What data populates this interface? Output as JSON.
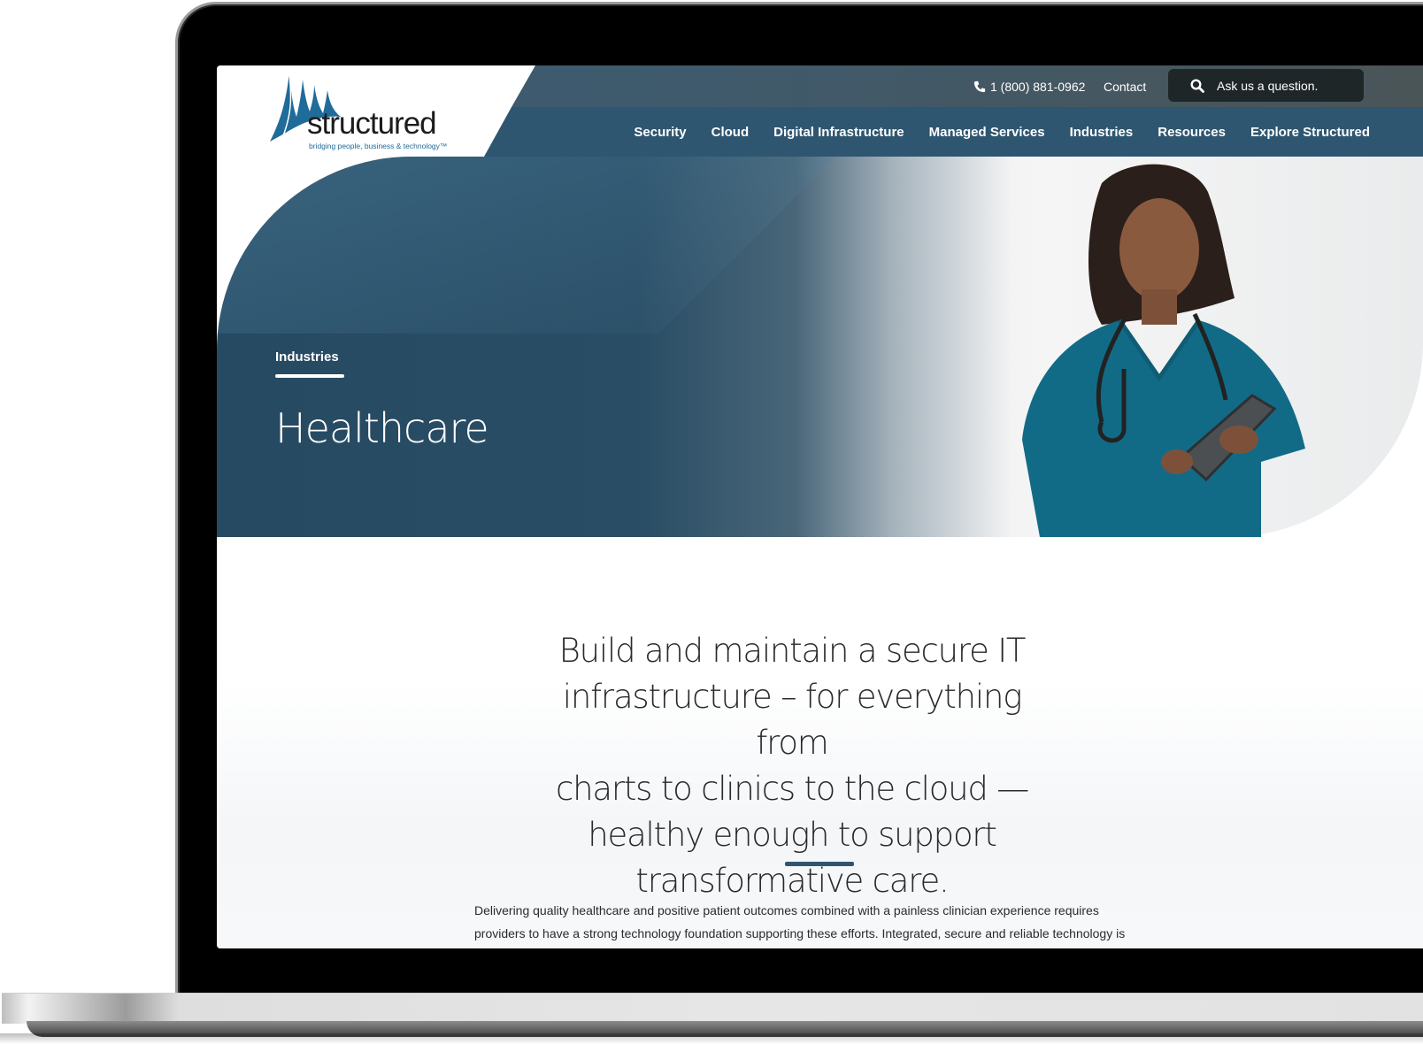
{
  "brand": {
    "name": "structured",
    "tagline": "bridging people, business & technology™",
    "accent_color": "#2f5670"
  },
  "utility_bar": {
    "phone_icon": "phone-icon",
    "phone": "1 (800) 881-0962",
    "contact_label": "Contact",
    "search": {
      "icon": "search-icon",
      "placeholder": "Ask us a question."
    }
  },
  "nav": {
    "items": [
      {
        "label": "Security"
      },
      {
        "label": "Cloud"
      },
      {
        "label": "Digital Infrastructure"
      },
      {
        "label": "Managed Services"
      },
      {
        "label": "Industries"
      },
      {
        "label": "Resources"
      },
      {
        "label": "Explore Structured"
      }
    ]
  },
  "hero": {
    "eyebrow": "Industries",
    "title": "Healthcare",
    "image_alt": "Nurse in teal scrubs with stethoscope using a tablet"
  },
  "main": {
    "lead_lines": [
      "Build and maintain a secure IT",
      "infrastructure – for everything from",
      "charts to clinics to the cloud —",
      "healthy enough to support",
      "transformative care."
    ],
    "paragraph_lines": [
      "Delivering quality healthcare and positive patient outcomes combined with a painless clinician experience requires",
      "providers to have a strong technology foundation supporting these efforts. Integrated, secure and reliable technology is"
    ]
  }
}
